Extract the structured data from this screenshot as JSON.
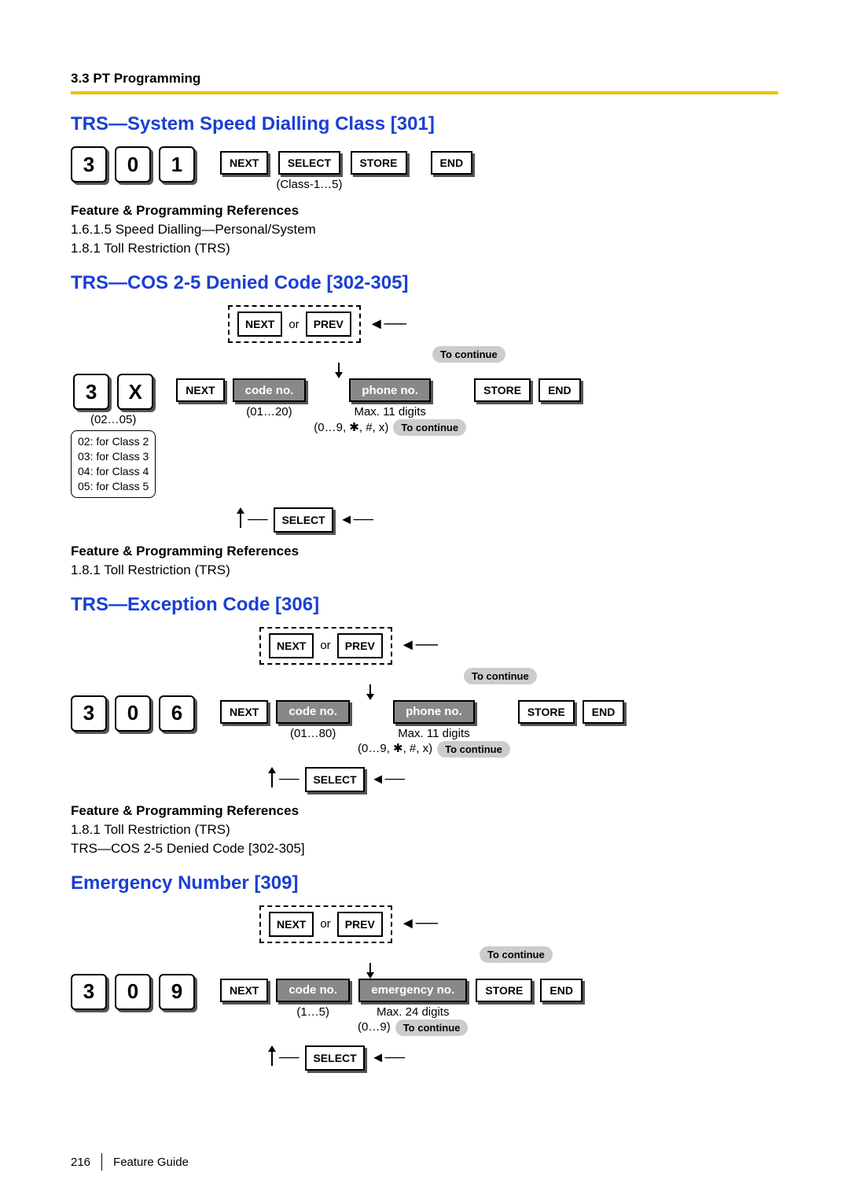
{
  "header": "3.3 PT Programming",
  "sections": {
    "s301": {
      "title": "TRS—System Speed Dialling Class [301]",
      "digits": [
        "3",
        "0",
        "1"
      ],
      "buttons": [
        "NEXT",
        "SELECT",
        "STORE",
        "END"
      ],
      "select_note": "(Class-1…5)",
      "refs_title": "Feature & Programming References",
      "refs": [
        "1.6.1.5 Speed Dialling—Personal/System",
        "1.8.1 Toll Restriction (TRS)"
      ]
    },
    "s302": {
      "title": "TRS—COS 2-5 Denied Code [302-305]",
      "digits": [
        "3",
        "X"
      ],
      "x_note_range": "(02…05)",
      "x_note_lines": [
        "02: for Class 2",
        "03: for Class 3",
        "04: for Class 4",
        "05: for Class 5"
      ],
      "nav": {
        "next": "NEXT",
        "or": "or",
        "prev": "PREV"
      },
      "to_continue": "To continue",
      "main_buttons": {
        "next": "NEXT",
        "code_label": "code no.",
        "code_note": "(01…20)",
        "phone_label": "phone no.",
        "phone_note1": "Max. 11 digits",
        "phone_note2": "(0…9, ✱, #, x)",
        "store": "STORE",
        "end": "END",
        "select": "SELECT"
      },
      "refs_title": "Feature & Programming References",
      "refs": [
        "1.8.1 Toll Restriction (TRS)"
      ]
    },
    "s306": {
      "title": "TRS—Exception Code [306]",
      "digits": [
        "3",
        "0",
        "6"
      ],
      "nav": {
        "next": "NEXT",
        "or": "or",
        "prev": "PREV"
      },
      "to_continue": "To continue",
      "main_buttons": {
        "next": "NEXT",
        "code_label": "code no.",
        "code_note": "(01…80)",
        "phone_label": "phone no.",
        "phone_note1": "Max. 11 digits",
        "phone_note2": "(0…9, ✱, #, x)",
        "store": "STORE",
        "end": "END",
        "select": "SELECT"
      },
      "refs_title": "Feature & Programming References",
      "refs": [
        "1.8.1 Toll Restriction (TRS)",
        "TRS—COS 2-5 Denied Code [302-305]"
      ]
    },
    "s309": {
      "title": "Emergency Number [309]",
      "digits": [
        "3",
        "0",
        "9"
      ],
      "nav": {
        "next": "NEXT",
        "or": "or",
        "prev": "PREV"
      },
      "to_continue": "To continue",
      "main_buttons": {
        "next": "NEXT",
        "code_label": "code no.",
        "code_note": "(1…5)",
        "phone_label": "emergency no.",
        "phone_note1": "Max. 24 digits",
        "phone_note2": "(0…9)",
        "store": "STORE",
        "end": "END",
        "select": "SELECT"
      }
    }
  },
  "footer": {
    "page": "216",
    "label": "Feature Guide"
  }
}
